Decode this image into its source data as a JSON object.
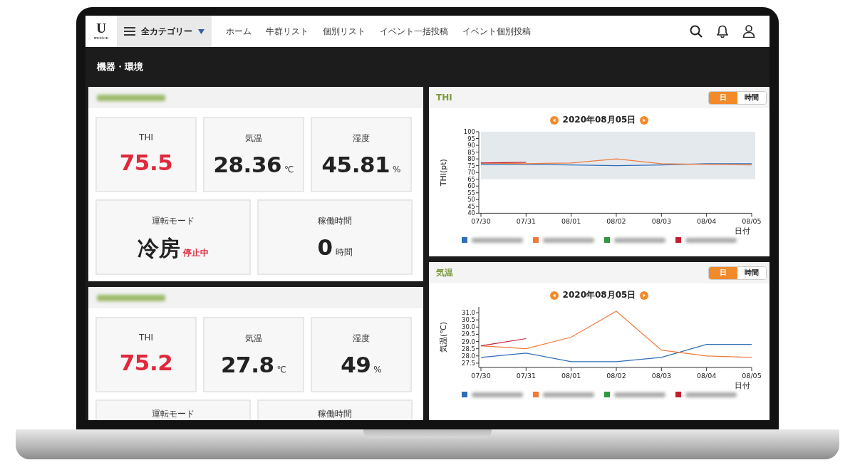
{
  "header": {
    "logo": {
      "letter": "U",
      "word": "motion"
    },
    "category_menu": {
      "label": "全カテゴリー"
    },
    "nav_links": [
      "ホーム",
      "牛群リスト",
      "個別リスト",
      "イベント一括投稿",
      "イベント個別投稿"
    ]
  },
  "page_title": "機器・環境",
  "device_panels": [
    {
      "metrics": [
        {
          "label": "THI",
          "value": "75.5",
          "alert": true
        },
        {
          "label": "気温",
          "value": "28.36",
          "unit": "℃",
          "alert": false
        },
        {
          "label": "湿度",
          "value": "45.81",
          "unit": "%",
          "alert": false
        }
      ],
      "modes": [
        {
          "label": "運転モード",
          "value": "冷房",
          "status": "停止中"
        },
        {
          "label": "稼働時間",
          "value": "0",
          "unit": "時間"
        }
      ]
    },
    {
      "metrics": [
        {
          "label": "THI",
          "value": "75.2",
          "alert": true
        },
        {
          "label": "気温",
          "value": "27.8",
          "unit": "℃",
          "alert": false
        },
        {
          "label": "湿度",
          "value": "49",
          "unit": "%",
          "alert": false
        }
      ],
      "modes": [
        {
          "label": "運転モード"
        },
        {
          "label": "稼働時間"
        }
      ]
    }
  ],
  "chart_panels": [
    {
      "title": "THI",
      "toggle": [
        {
          "label": "日",
          "selected": true
        },
        {
          "label": "時間",
          "selected": false
        }
      ],
      "date": "2020年08月05日",
      "chart_data": {
        "type": "line",
        "xlabel": "日付",
        "ylabel": "THI(pt)",
        "categories": [
          "07/30",
          "07/31",
          "08/01",
          "08/02",
          "08/03",
          "08/04",
          "08/05"
        ],
        "ylim": [
          40,
          100
        ],
        "yticks": [
          40,
          45,
          50,
          55,
          60,
          65,
          70,
          75,
          80,
          85,
          90,
          95,
          100
        ],
        "bands": [
          {
            "axis": "y",
            "from": 65,
            "to": 100
          }
        ],
        "series": [
          {
            "color": "#2f6db5",
            "values": [
              76,
              76,
              75.5,
              75,
              75.5,
              76.5,
              76.5
            ]
          },
          {
            "color": "#f07a3a",
            "values": [
              77,
              76.5,
              77,
              80,
              76.5,
              76,
              75.5
            ]
          },
          {
            "color": "#2e9a3e",
            "values": [
              null,
              null,
              null,
              null,
              null,
              null,
              null
            ]
          },
          {
            "color": "#c41e2e",
            "values": [
              77,
              77.5,
              null,
              null,
              null,
              null,
              null
            ]
          }
        ]
      }
    },
    {
      "title": "気温",
      "toggle": [
        {
          "label": "日",
          "selected": true
        },
        {
          "label": "時間",
          "selected": false
        }
      ],
      "date": "2020年08月05日",
      "chart_data": {
        "type": "line",
        "xlabel": "日付",
        "ylabel": "気温(℃)",
        "categories": [
          "07/30",
          "07/31",
          "08/01",
          "08/02",
          "08/03",
          "08/04",
          "08/05"
        ],
        "ylim": [
          27.2,
          31.4
        ],
        "yticks": [
          {
            "value": 27.5,
            "label": "27.5"
          },
          {
            "value": 28,
            "label": "28.0"
          },
          {
            "value": 28.5,
            "label": "28.5"
          },
          {
            "value": 29,
            "label": "29.0"
          },
          {
            "value": 29.5,
            "label": "29.5"
          },
          {
            "value": 30,
            "label": "30.0"
          },
          {
            "value": 30.5,
            "label": "30.5"
          },
          {
            "value": 31,
            "label": "31.0"
          }
        ],
        "series": [
          {
            "color": "#2f6db5",
            "values": [
              27.9,
              28.2,
              27.6,
              27.6,
              27.9,
              28.8,
              28.8
            ]
          },
          {
            "color": "#f07a3a",
            "values": [
              28.7,
              28.5,
              29.3,
              31.1,
              28.4,
              28.0,
              27.9
            ]
          },
          {
            "color": "#2e9a3e",
            "values": [
              null,
              null,
              null,
              null,
              null,
              null,
              null
            ]
          },
          {
            "color": "#c41e2e",
            "values": [
              28.7,
              29.2,
              null,
              null,
              null,
              null,
              null
            ]
          }
        ]
      }
    }
  ]
}
